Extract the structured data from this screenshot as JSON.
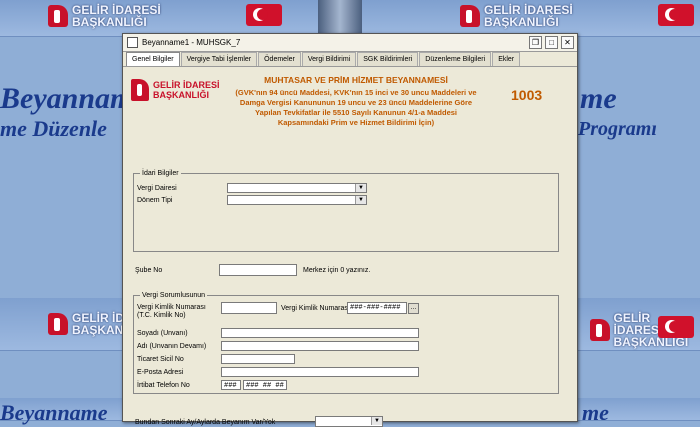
{
  "background": {
    "logo_line1": "GELİR İDARESİ",
    "logo_line2": "BAŞKANLIĞI",
    "banner_line1": "Beyanname",
    "banner_line2": "me Düzenle",
    "banner_right1": "me",
    "banner_right2": "Programı"
  },
  "window": {
    "title": "Beyanname1 - MUHSGK_7"
  },
  "tabs": [
    {
      "label": "Genel Bilgiler"
    },
    {
      "label": "Vergiye Tabi İşlemler"
    },
    {
      "label": "Ödemeler"
    },
    {
      "label": "Vergi Bildirimi"
    },
    {
      "label": "SGK Bildirimleri"
    },
    {
      "label": "Düzenleme Bilgileri"
    },
    {
      "label": "Ekler"
    }
  ],
  "header": {
    "logo_line1": "GELİR İDARESİ",
    "logo_line2": "BAŞKANLIĞI",
    "title": "MUHTASAR VE PRİM HİZMET BEYANNAMESİ",
    "description": "(GVK'nın 94 üncü Maddesi, KVK'nın 15 inci ve 30 uncu Maddeleri ve Damga Vergisi Kanununun 19 uncu ve 23 üncü Maddelerine Göre Yapılan Tevkifatlar ile 5510 Sayılı Kanunun 4/1-a Maddesi Kapsamındaki Prim ve Hizmet Bildirimi İçin)",
    "form_number": "1003"
  },
  "idari": {
    "legend": "İdari Bilgiler",
    "vergi_dairesi_label": "Vergi Dairesi",
    "donem_tipi_label": "Dönem Tipi"
  },
  "sube": {
    "label": "Şube No",
    "hint": "Merkez için 0 yazınız."
  },
  "vergi_sorumlusu": {
    "legend": "Vergi Sorumlusunun",
    "vkn_label": "Vergi Kimlik Numarası (T.C. Kimlik No)",
    "vkn2_label": "Vergi Kimlik Numarası",
    "vkn2_value": "###-###-####",
    "lookup_button": "...",
    "soyadi_label": "Soyadı (Unvanı)",
    "adi_label": "Adı (Unvanın Devamı)",
    "ticaret_label": "Ticaret Sicil No",
    "eposta_label": "E-Posta Adresi",
    "telefon_label": "İrtibat Telefon No",
    "telefon_code": "###",
    "telefon_number": "### ## ##"
  },
  "bundan_sonraki": {
    "label": "Bundan Sonraki Ay/Aylarda Beyanım Var/Yok"
  }
}
